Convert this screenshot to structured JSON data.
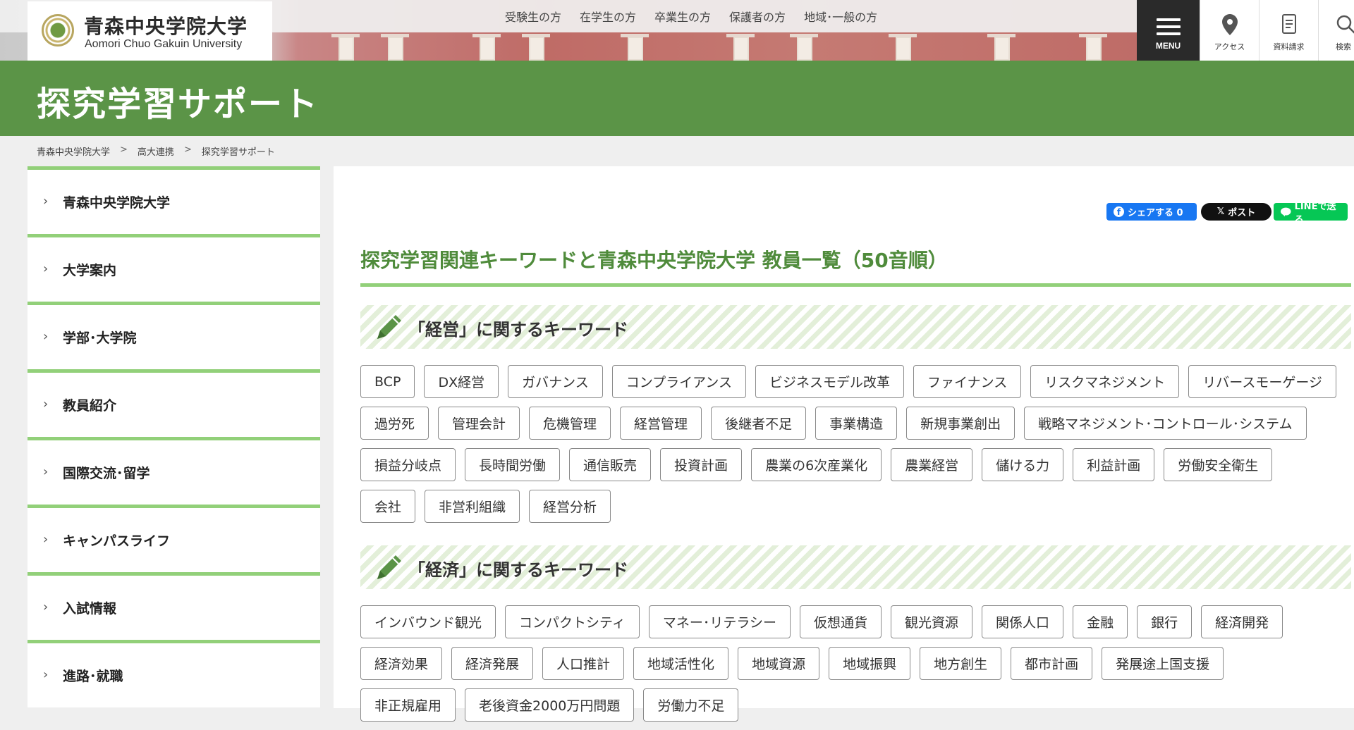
{
  "header": {
    "logo_jp": "青森中央学院大学",
    "logo_en": "Aomori Chuo Gakuin University",
    "topnav": [
      "受験生の方",
      "在学生の方",
      "卒業生の方",
      "保護者の方",
      "地域･一般の方"
    ],
    "menu_label": "MENU",
    "access_label": "アクセス",
    "request_label": "資料請求",
    "search_label": "検索"
  },
  "banner": {
    "title": "探究学習サポート"
  },
  "breadcrumb": [
    "青森中央学院大学",
    "高大連携",
    "探究学習サポート"
  ],
  "breadcrumb_sep": ">",
  "sidebar": {
    "items": [
      {
        "label": "青森中央学院大学"
      },
      {
        "label": "大学案内"
      },
      {
        "label": "学部･大学院"
      },
      {
        "label": "教員紹介"
      },
      {
        "label": "国際交流･留学"
      },
      {
        "label": "キャンパスライフ"
      },
      {
        "label": "入試情報"
      },
      {
        "label": "進路･就職"
      }
    ]
  },
  "share": {
    "facebook": "シェアする 0",
    "x": "ポスト",
    "line": "LINEで送る"
  },
  "main": {
    "heading": "探究学習関連キーワードと青森中央学院大学 教員一覧（50音順）",
    "sections": [
      {
        "title": "「経営」に関するキーワード",
        "rows": [
          [
            "BCP",
            "DX経営",
            "ガバナンス",
            "コンプライアンス",
            "ビジネスモデル改革",
            "ファイナンス",
            "リスクマネジメント",
            "リバースモーゲージ"
          ],
          [
            "過労死",
            "管理会計",
            "危機管理",
            "経営管理",
            "後継者不足",
            "事業構造",
            "新規事業創出",
            "戦略マネジメント･コントロール･システム"
          ],
          [
            "損益分岐点",
            "長時間労働",
            "通信販売",
            "投資計画",
            "農業の6次産業化",
            "農業経営",
            "儲ける力",
            "利益計画",
            "労働安全衛生"
          ],
          [
            "会社",
            "非営利組織",
            "経営分析"
          ]
        ]
      },
      {
        "title": "「経済」に関するキーワード",
        "rows": [
          [
            "インバウンド観光",
            "コンパクトシティ",
            "マネー･リテラシー",
            "仮想通貨",
            "観光資源",
            "関係人口",
            "金融",
            "銀行",
            "経済開発"
          ],
          [
            "経済効果",
            "経済発展",
            "人口推計",
            "地域活性化",
            "地域資源",
            "地域振興",
            "地方創生",
            "都市計画",
            "発展途上国支援"
          ],
          [
            "非正規雇用",
            "老後資金2000万円問題",
            "労働力不足"
          ]
        ]
      }
    ]
  },
  "colors": {
    "green_banner": "#5b9447",
    "green_accent": "#92d079",
    "heading_green": "#4f8b3b"
  }
}
